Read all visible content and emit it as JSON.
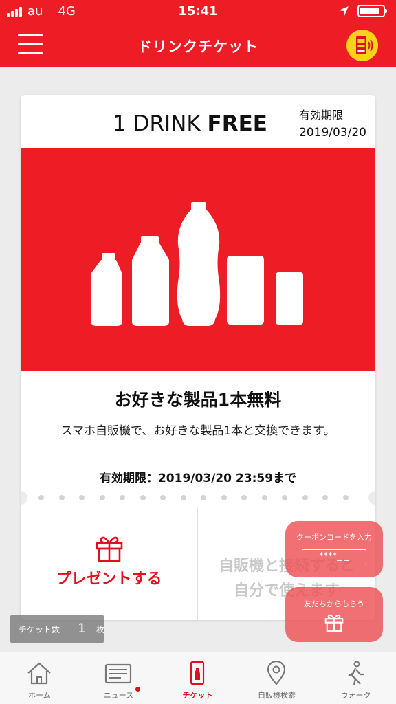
{
  "status_bar": {
    "carrier": "au",
    "network": "4G",
    "time": "15:41",
    "battery_level": 0.85
  },
  "header": {
    "title": "ドリンクチケット",
    "menu_icon": "hamburger-menu-icon",
    "right_icon": "vending-machine-icon"
  },
  "ticket": {
    "headline_prefix": "1 DRINK ",
    "headline_bold": "FREE",
    "expiry_label": "有効期限",
    "expiry_date": "2019/03/20",
    "product_title": "お好きな製品1本無料",
    "product_desc": "スマホ自販機で、お好きな製品1本と交換できます。",
    "valid_until": "有効期限：2019/03/20 23:59まで",
    "present_label": "プレゼントする",
    "connect_line1": "自販機と接続すると",
    "connect_line2": "自分で使えます"
  },
  "floating": {
    "coupon_label": "クーポンコードを入力",
    "coupon_placeholder": "****_ _",
    "friend_label": "友だちからもらう"
  },
  "ticket_count": {
    "label": "チケット数",
    "value": "1",
    "unit": "枚"
  },
  "tabs": [
    {
      "label": "ホーム",
      "icon": "home-icon"
    },
    {
      "label": "ニュース",
      "icon": "news-icon"
    },
    {
      "label": "チケット",
      "icon": "ticket-icon"
    },
    {
      "label": "自販機検索",
      "icon": "map-pin-icon"
    },
    {
      "label": "ウォーク",
      "icon": "walk-icon"
    }
  ],
  "colors": {
    "brand_red": "#ee1c25",
    "accent_yellow": "#f7d417",
    "background": "#ececec"
  }
}
